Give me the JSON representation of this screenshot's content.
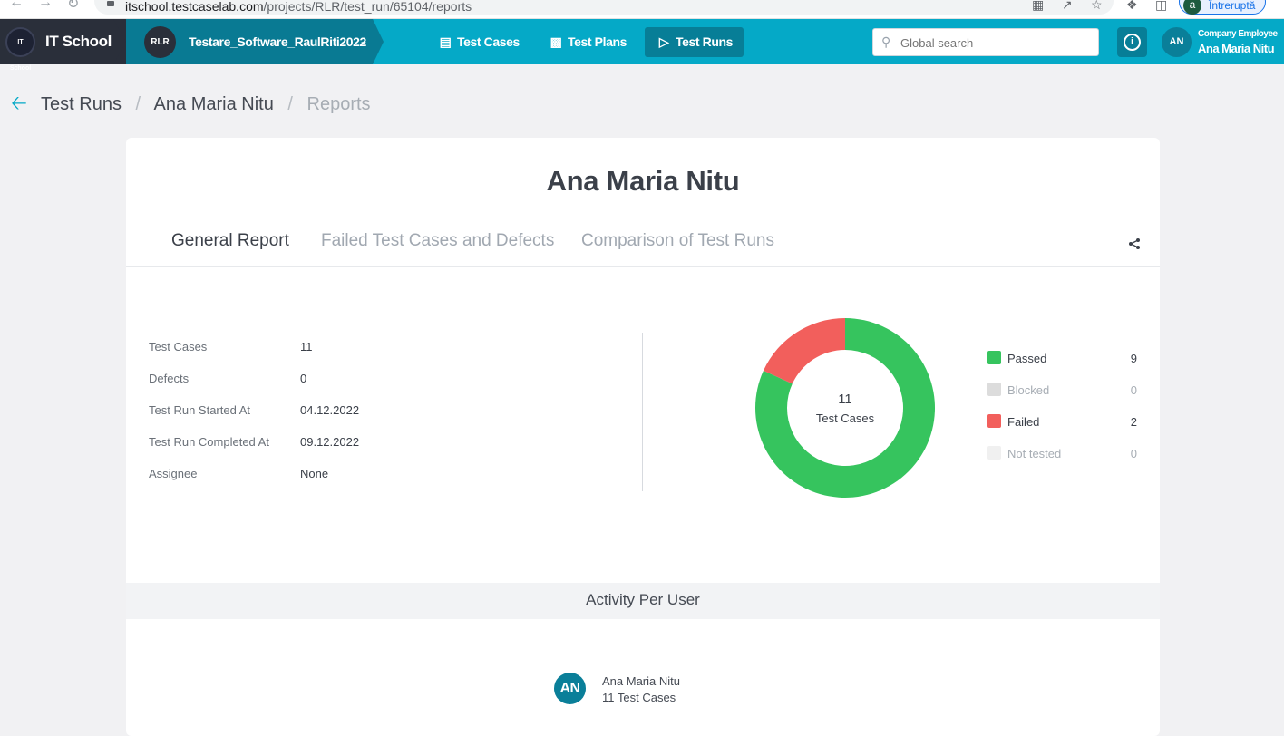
{
  "browser": {
    "url_host": "itschool.testcaselab.com",
    "url_path": "/projects/RLR/test_run/65104/reports",
    "profile_initial": "a",
    "profile_label": "Întreruptă"
  },
  "topnav": {
    "brand_logo_text": "IT School",
    "brand_name": "IT School",
    "project_badge": "RLR",
    "project_name": "Testare_Software_RaulRiti2022",
    "links": [
      {
        "label": "Test Cases",
        "icon": "test-cases-icon"
      },
      {
        "label": "Test Plans",
        "icon": "test-plans-icon"
      },
      {
        "label": "Test Runs",
        "icon": "test-runs-icon",
        "active": true
      }
    ],
    "search_placeholder": "Global search",
    "user_initials": "AN",
    "user_role": "Company Employee",
    "user_name": "Ana Maria Nitu"
  },
  "breadcrumb": {
    "items": [
      "Test Runs",
      "Ana Maria Nitu"
    ],
    "current": "Reports"
  },
  "report": {
    "title": "Ana Maria Nitu",
    "tabs": [
      "General Report",
      "Failed Test Cases and Defects",
      "Comparison of Test Runs"
    ],
    "active_tab": "General Report",
    "details": [
      {
        "label": "Test Cases",
        "value": "11"
      },
      {
        "label": "Defects",
        "value": "0"
      },
      {
        "label": "Test Run Started At",
        "value": "04.12.2022"
      },
      {
        "label": "Test Run Completed At",
        "value": "09.12.2022"
      },
      {
        "label": "Assignee",
        "value": "None"
      }
    ]
  },
  "chart_data": {
    "type": "pie",
    "center_value": "11",
    "center_label": "Test Cases",
    "categories": [
      "Passed",
      "Blocked",
      "Failed",
      "Not tested"
    ],
    "values": [
      9,
      0,
      2,
      0
    ],
    "colors": [
      "#36c45e",
      "#dcdcdc",
      "#f25f5c",
      "#f0f0f0"
    ],
    "legend_placement": "right"
  },
  "activity": {
    "title": "Activity Per User",
    "users": [
      {
        "initials": "AN",
        "name": "Ana Maria Nitu",
        "count": "11 Test Cases"
      }
    ]
  }
}
